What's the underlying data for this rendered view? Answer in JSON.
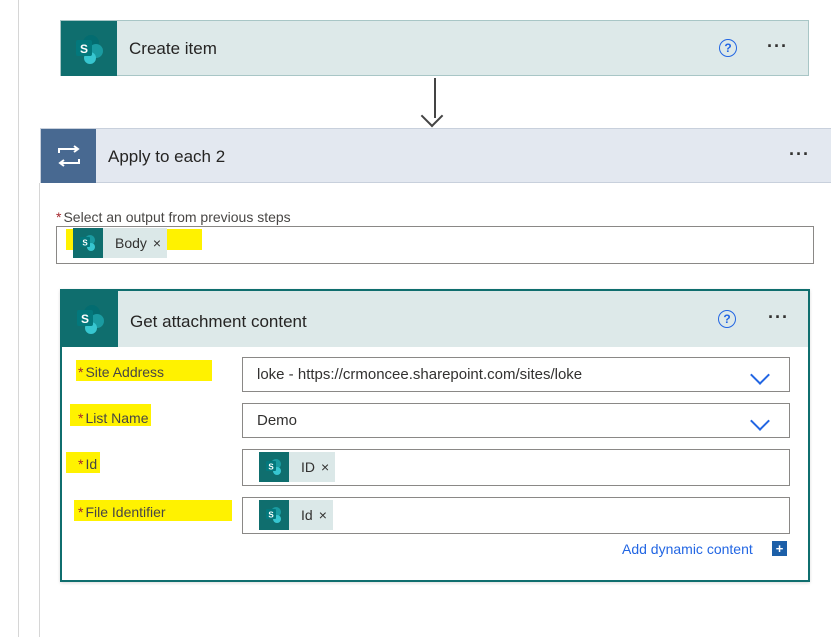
{
  "create_item": {
    "title": "Create item"
  },
  "apply_each": {
    "title": "Apply to each 2",
    "output_label": "Select an output from previous steps",
    "output_token": "Body"
  },
  "get_attachment": {
    "title": "Get attachment content",
    "fields": {
      "site_address": {
        "label": "Site Address",
        "value": "loke - https://crmoncee.sharepoint.com/sites/loke"
      },
      "list_name": {
        "label": "List Name",
        "value": "Demo"
      },
      "id": {
        "label": "Id",
        "token": "ID"
      },
      "file_identifier": {
        "label": "File Identifier",
        "token": "Id"
      }
    },
    "add_dynamic": "Add dynamic content"
  },
  "ui": {
    "required_mark": "*",
    "token_remove": "×",
    "more_menu": "···",
    "help": "?",
    "sp_letter": "S",
    "plus": "+"
  },
  "colors": {
    "sharepoint_teal": "#0f6e6e",
    "loop_blue": "#486991",
    "highlight_yellow": "#fff200",
    "link_blue": "#2266e3"
  }
}
